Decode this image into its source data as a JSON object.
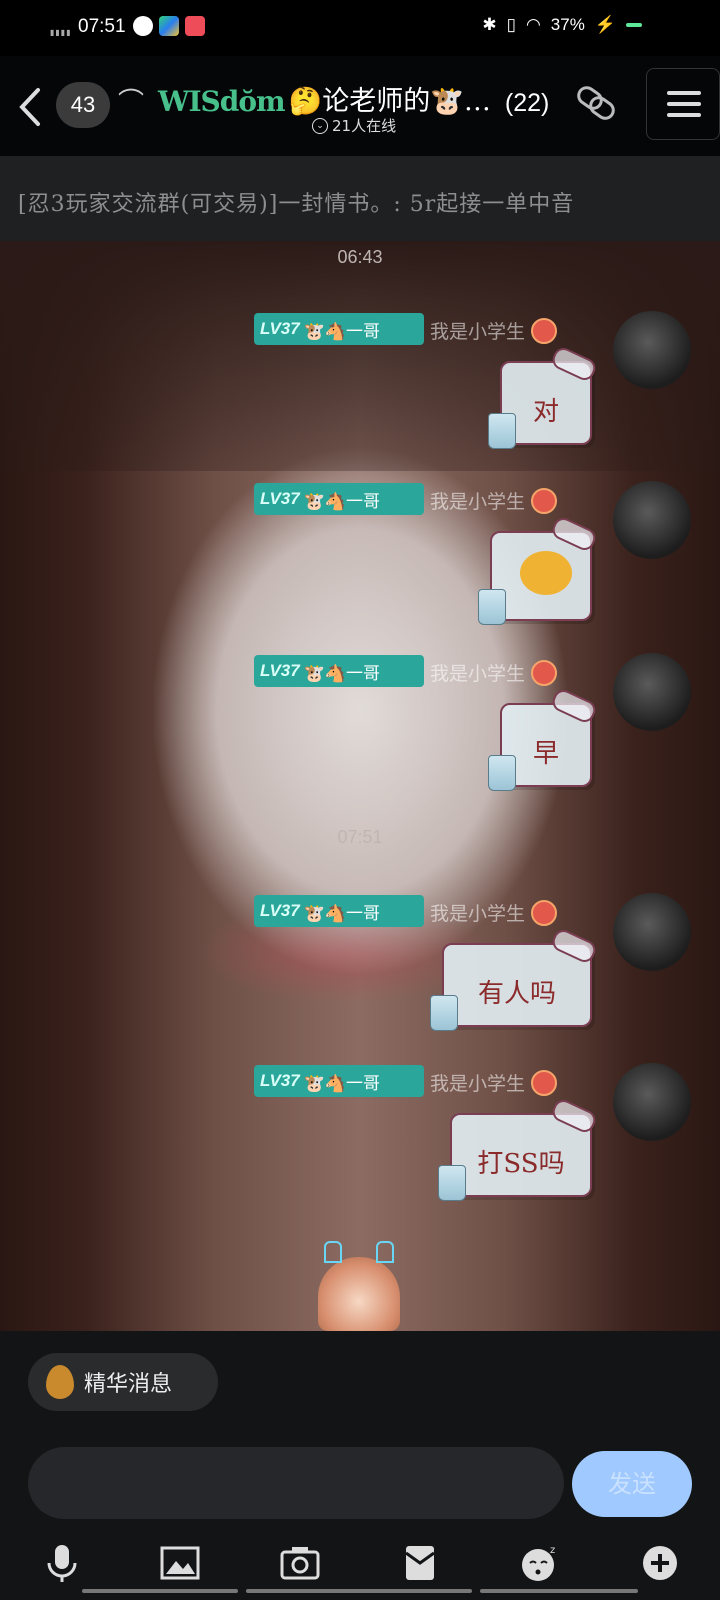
{
  "status_bar": {
    "time": "07:51",
    "battery": "37%"
  },
  "header": {
    "back_label": "‹",
    "unread_count": "43",
    "logo_text": "WISdŏm",
    "title": "🤔论老师的🐮…",
    "member_count": "(22)",
    "online": "21人在线"
  },
  "notice": {
    "text": "[忍3玩家交流群(可交易)]一封情书。: 5r起接一单中音"
  },
  "messages": {
    "timestamps": [
      "06:43",
      "07:51"
    ],
    "items": [
      {
        "level": "LV37",
        "nickname": "🐮🐴一哥",
        "username": "我是小学生",
        "text": "对"
      },
      {
        "level": "LV37",
        "nickname": "🐮🐴一哥",
        "username": "我是小学生",
        "text": ""
      },
      {
        "level": "LV37",
        "nickname": "🐮🐴一哥",
        "username": "我是小学生",
        "text": "早"
      },
      {
        "level": "LV37",
        "nickname": "🐮🐴一哥",
        "username": "我是小学生",
        "text": "有人吗"
      },
      {
        "level": "LV37",
        "nickname": "🐮🐴一哥",
        "username": "我是小学生",
        "text": "打SS吗"
      }
    ]
  },
  "composer": {
    "digest_label": "精华消息",
    "input_value": "",
    "send_label": "发送"
  },
  "colors": {
    "level_badge": "#2aa69a",
    "send_button": "#9fc9ff",
    "bubble_text": "#8b2a2a"
  }
}
